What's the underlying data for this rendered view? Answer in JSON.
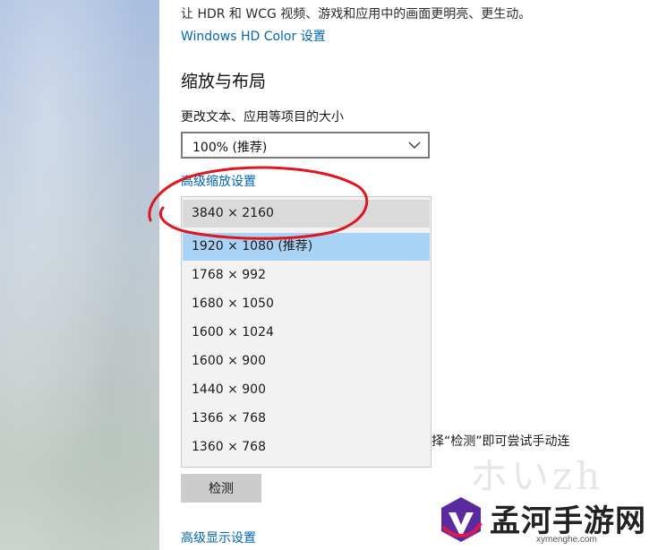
{
  "display": {
    "hdr_description": "让 HDR 和 WCG 视频、游戏和应用中的画面更明亮、更生动。",
    "hdr_link": "Windows HD Color 设置",
    "scale_section_title": "缩放与布局",
    "scale_label": "更改文本、应用等项目的大小",
    "scale_value": "100% (推荐)",
    "advanced_scaling_link": "高级缩放设置",
    "resolution_options": [
      "3840 × 2160",
      "1920 × 1080 (推荐)",
      "1768 × 992",
      "1680 × 1050",
      "1600 × 1024",
      "1600 × 900",
      "1440 × 900",
      "1366 × 768",
      "1360 × 768"
    ],
    "resolution_hover_index": 0,
    "resolution_selected_index": 1,
    "partial_text": "选择“检测”即可尝试手动连",
    "detect_button": "检测",
    "advanced_display_link": "高级显示设置"
  },
  "watermark": {
    "name": "孟河手游网",
    "url": "xymenghe.com",
    "faint_text": "ホいzh"
  },
  "annotation_color": "#e0161e",
  "accent_link_color": "#0066b4",
  "selected_color": "#a9d3f5"
}
